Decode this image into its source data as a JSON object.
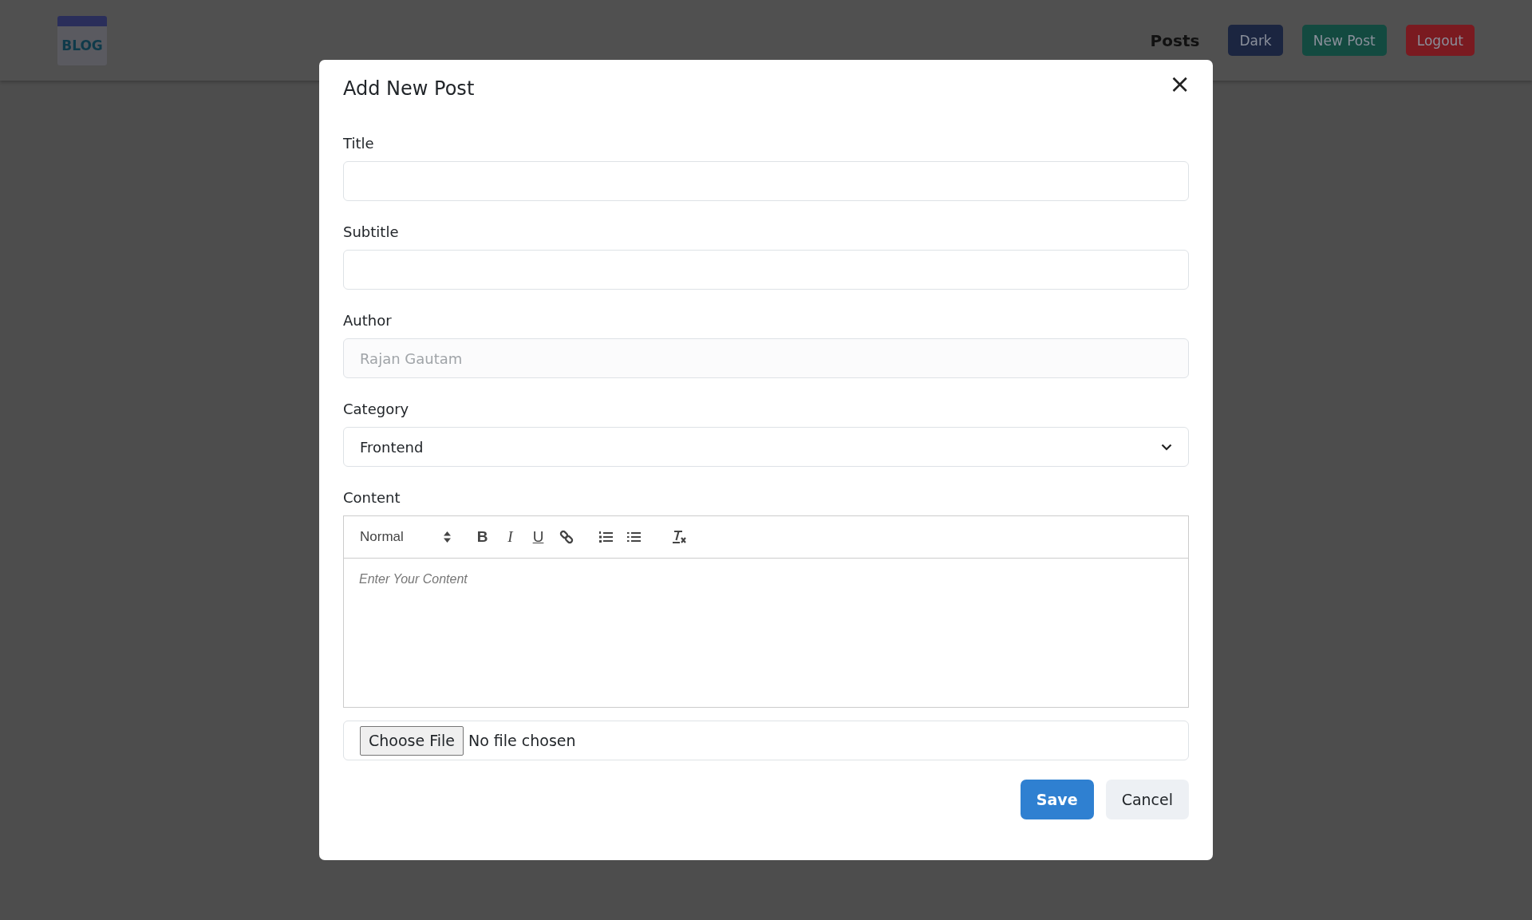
{
  "header": {
    "logo": "BLOG",
    "nav": [
      {
        "label": "Posts",
        "kind": "link"
      },
      {
        "label": "Dark",
        "kind": "button",
        "color": "#1b2540"
      },
      {
        "label": "New Post",
        "kind": "button",
        "color": "#134a40"
      },
      {
        "label": "Logout",
        "kind": "button",
        "color": "#7a1a20"
      }
    ]
  },
  "modal": {
    "title": "Add New Post",
    "close": "×",
    "fields": [
      {
        "kind": "text",
        "label": "Title"
      },
      {
        "kind": "text",
        "label": "Subtitle"
      },
      {
        "kind": "text",
        "label": "Author",
        "value": "Rajan Gautam",
        "disabled": true
      },
      {
        "kind": "select",
        "label": "Category",
        "value": "Frontend"
      },
      {
        "kind": "editor",
        "label": "Content",
        "format": "Normal",
        "marks": [
          "B",
          "I",
          "U"
        ],
        "placeholder": "Enter Your Content"
      },
      {
        "kind": "file",
        "button": "Choose File",
        "status": "No file chosen"
      }
    ],
    "buttons": [
      {
        "label": "Save",
        "kind": "primary"
      },
      {
        "label": "Cancel",
        "kind": "secondary"
      }
    ]
  }
}
